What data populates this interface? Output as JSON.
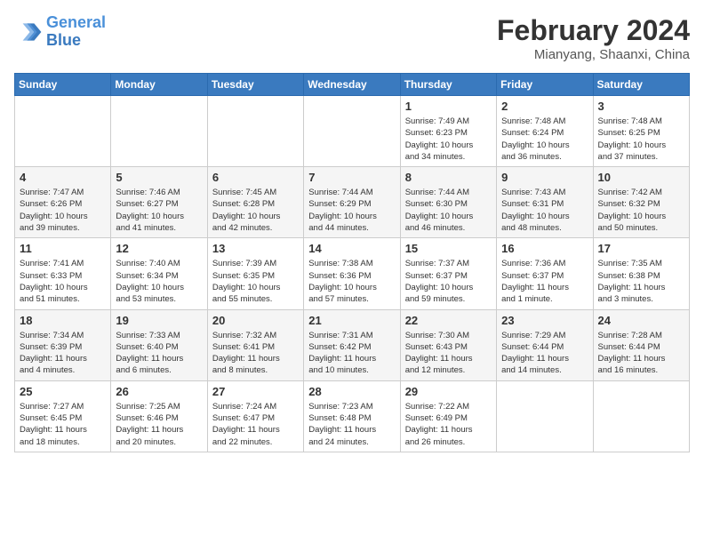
{
  "header": {
    "logo_line1": "General",
    "logo_line2": "Blue",
    "title": "February 2024",
    "location": "Mianyang, Shaanxi, China"
  },
  "days_of_week": [
    "Sunday",
    "Monday",
    "Tuesday",
    "Wednesday",
    "Thursday",
    "Friday",
    "Saturday"
  ],
  "weeks": [
    [
      {
        "day": "",
        "info": ""
      },
      {
        "day": "",
        "info": ""
      },
      {
        "day": "",
        "info": ""
      },
      {
        "day": "",
        "info": ""
      },
      {
        "day": "1",
        "info": "Sunrise: 7:49 AM\nSunset: 6:23 PM\nDaylight: 10 hours\nand 34 minutes."
      },
      {
        "day": "2",
        "info": "Sunrise: 7:48 AM\nSunset: 6:24 PM\nDaylight: 10 hours\nand 36 minutes."
      },
      {
        "day": "3",
        "info": "Sunrise: 7:48 AM\nSunset: 6:25 PM\nDaylight: 10 hours\nand 37 minutes."
      }
    ],
    [
      {
        "day": "4",
        "info": "Sunrise: 7:47 AM\nSunset: 6:26 PM\nDaylight: 10 hours\nand 39 minutes."
      },
      {
        "day": "5",
        "info": "Sunrise: 7:46 AM\nSunset: 6:27 PM\nDaylight: 10 hours\nand 41 minutes."
      },
      {
        "day": "6",
        "info": "Sunrise: 7:45 AM\nSunset: 6:28 PM\nDaylight: 10 hours\nand 42 minutes."
      },
      {
        "day": "7",
        "info": "Sunrise: 7:44 AM\nSunset: 6:29 PM\nDaylight: 10 hours\nand 44 minutes."
      },
      {
        "day": "8",
        "info": "Sunrise: 7:44 AM\nSunset: 6:30 PM\nDaylight: 10 hours\nand 46 minutes."
      },
      {
        "day": "9",
        "info": "Sunrise: 7:43 AM\nSunset: 6:31 PM\nDaylight: 10 hours\nand 48 minutes."
      },
      {
        "day": "10",
        "info": "Sunrise: 7:42 AM\nSunset: 6:32 PM\nDaylight: 10 hours\nand 50 minutes."
      }
    ],
    [
      {
        "day": "11",
        "info": "Sunrise: 7:41 AM\nSunset: 6:33 PM\nDaylight: 10 hours\nand 51 minutes."
      },
      {
        "day": "12",
        "info": "Sunrise: 7:40 AM\nSunset: 6:34 PM\nDaylight: 10 hours\nand 53 minutes."
      },
      {
        "day": "13",
        "info": "Sunrise: 7:39 AM\nSunset: 6:35 PM\nDaylight: 10 hours\nand 55 minutes."
      },
      {
        "day": "14",
        "info": "Sunrise: 7:38 AM\nSunset: 6:36 PM\nDaylight: 10 hours\nand 57 minutes."
      },
      {
        "day": "15",
        "info": "Sunrise: 7:37 AM\nSunset: 6:37 PM\nDaylight: 10 hours\nand 59 minutes."
      },
      {
        "day": "16",
        "info": "Sunrise: 7:36 AM\nSunset: 6:37 PM\nDaylight: 11 hours\nand 1 minute."
      },
      {
        "day": "17",
        "info": "Sunrise: 7:35 AM\nSunset: 6:38 PM\nDaylight: 11 hours\nand 3 minutes."
      }
    ],
    [
      {
        "day": "18",
        "info": "Sunrise: 7:34 AM\nSunset: 6:39 PM\nDaylight: 11 hours\nand 4 minutes."
      },
      {
        "day": "19",
        "info": "Sunrise: 7:33 AM\nSunset: 6:40 PM\nDaylight: 11 hours\nand 6 minutes."
      },
      {
        "day": "20",
        "info": "Sunrise: 7:32 AM\nSunset: 6:41 PM\nDaylight: 11 hours\nand 8 minutes."
      },
      {
        "day": "21",
        "info": "Sunrise: 7:31 AM\nSunset: 6:42 PM\nDaylight: 11 hours\nand 10 minutes."
      },
      {
        "day": "22",
        "info": "Sunrise: 7:30 AM\nSunset: 6:43 PM\nDaylight: 11 hours\nand 12 minutes."
      },
      {
        "day": "23",
        "info": "Sunrise: 7:29 AM\nSunset: 6:44 PM\nDaylight: 11 hours\nand 14 minutes."
      },
      {
        "day": "24",
        "info": "Sunrise: 7:28 AM\nSunset: 6:44 PM\nDaylight: 11 hours\nand 16 minutes."
      }
    ],
    [
      {
        "day": "25",
        "info": "Sunrise: 7:27 AM\nSunset: 6:45 PM\nDaylight: 11 hours\nand 18 minutes."
      },
      {
        "day": "26",
        "info": "Sunrise: 7:25 AM\nSunset: 6:46 PM\nDaylight: 11 hours\nand 20 minutes."
      },
      {
        "day": "27",
        "info": "Sunrise: 7:24 AM\nSunset: 6:47 PM\nDaylight: 11 hours\nand 22 minutes."
      },
      {
        "day": "28",
        "info": "Sunrise: 7:23 AM\nSunset: 6:48 PM\nDaylight: 11 hours\nand 24 minutes."
      },
      {
        "day": "29",
        "info": "Sunrise: 7:22 AM\nSunset: 6:49 PM\nDaylight: 11 hours\nand 26 minutes."
      },
      {
        "day": "",
        "info": ""
      },
      {
        "day": "",
        "info": ""
      }
    ]
  ]
}
